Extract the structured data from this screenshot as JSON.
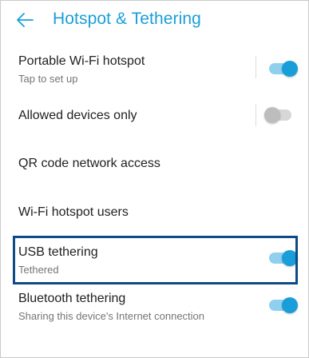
{
  "header": {
    "title": "Hotspot & Tethering",
    "back_icon": "arrow-left-icon"
  },
  "colors": {
    "accent": "#1a9ed9",
    "accent_track": "#8fd0ef",
    "highlight_border": "#0e4a86",
    "text_primary": "#212121",
    "text_secondary": "#757575"
  },
  "settings": {
    "portable_hotspot": {
      "label": "Portable Wi-Fi hotspot",
      "subtitle": "Tap to set up",
      "state": "on"
    },
    "allowed_devices": {
      "label": "Allowed devices only",
      "state": "off"
    },
    "qr_code": {
      "label": "QR code network access"
    },
    "hotspot_users": {
      "label": "Wi-Fi hotspot users"
    },
    "usb_tethering": {
      "label": "USB tethering",
      "subtitle": "Tethered",
      "state": "on"
    },
    "bluetooth_tethering": {
      "label": "Bluetooth tethering",
      "subtitle": "Sharing this device's Internet connection",
      "state": "on"
    }
  }
}
